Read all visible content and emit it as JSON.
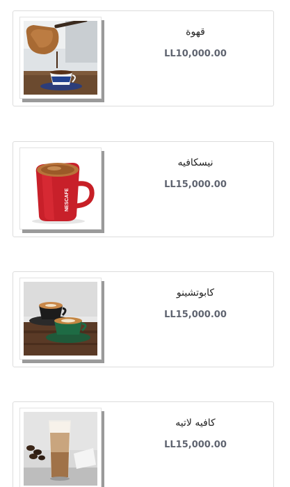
{
  "products": [
    {
      "name": "قهوة",
      "price": "LL10,000.00",
      "image_icon": "turkish-coffee-pot-icon"
    },
    {
      "name": "نيسكافيه",
      "price": "LL15,000.00",
      "image_icon": "nescafe-mug-icon"
    },
    {
      "name": "كابوتشينو",
      "price": "LL15,000.00",
      "image_icon": "cappuccino-cups-icon"
    },
    {
      "name": "كافيه لاتيه",
      "price": "LL15,000.00",
      "image_icon": "latte-glass-icon"
    }
  ],
  "nescafe_mug_label": "NESCAFE",
  "colors": {
    "card_border": "#dcdcdc",
    "price_text": "#5f6470",
    "name_text": "#222222",
    "thumb_shadow": "#9a9a9a"
  }
}
